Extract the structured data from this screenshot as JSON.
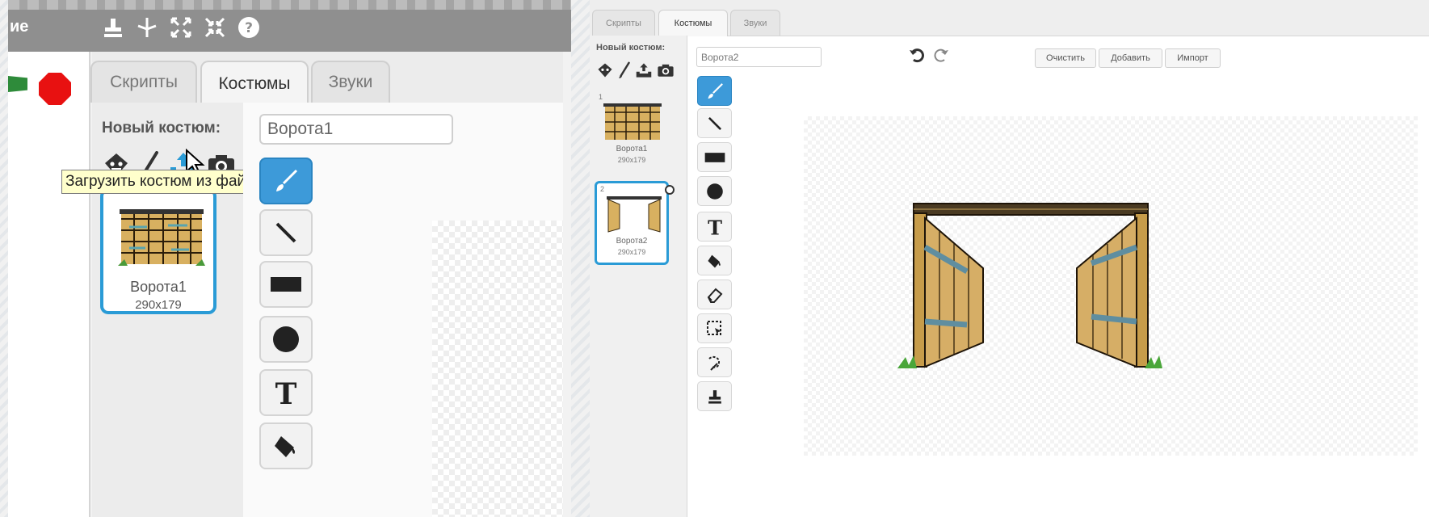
{
  "left_panel": {
    "title_fragment": "ие",
    "tabs": [
      "Скрипты",
      "Костюмы",
      "Звуки"
    ],
    "active_tab": "Костюмы",
    "new_costume_label": "Новый костюм:",
    "tooltip": "Загрузить костюм из файла",
    "costume": {
      "name": "Ворота1",
      "size": "290x179"
    },
    "name_field_value": "Ворота1",
    "toolbar_icons": [
      "stamp-icon",
      "cut-icon",
      "grow-icon",
      "shrink-icon",
      "help-icon"
    ],
    "new_costume_icons": [
      "library-icon",
      "paint-icon",
      "upload-icon",
      "camera-icon"
    ],
    "tools": [
      "brush",
      "line",
      "rectangle",
      "ellipse",
      "text",
      "fill"
    ]
  },
  "right_panel": {
    "tabs": [
      "Скрипты",
      "Костюмы",
      "Звуки"
    ],
    "active_tab": "Костюмы",
    "new_costume_label": "Новый костюм:",
    "costumes": [
      {
        "index": "1",
        "name": "Ворота1",
        "size": "290x179"
      },
      {
        "index": "2",
        "name": "Ворота2",
        "size": "290x179"
      }
    ],
    "name_field_value": "Ворота2",
    "buttons": {
      "clear": "Очистить",
      "add": "Добавить",
      "import": "Импорт"
    },
    "tools": [
      "brush",
      "line",
      "rectangle",
      "ellipse",
      "text",
      "fill",
      "eraser",
      "select",
      "select-remove-bg",
      "stamp"
    ]
  },
  "colors": {
    "accent": "#2a9bd6",
    "active_tool": "#3d9ad9",
    "stop": "#e81111",
    "flag": "#2e8b3a"
  }
}
